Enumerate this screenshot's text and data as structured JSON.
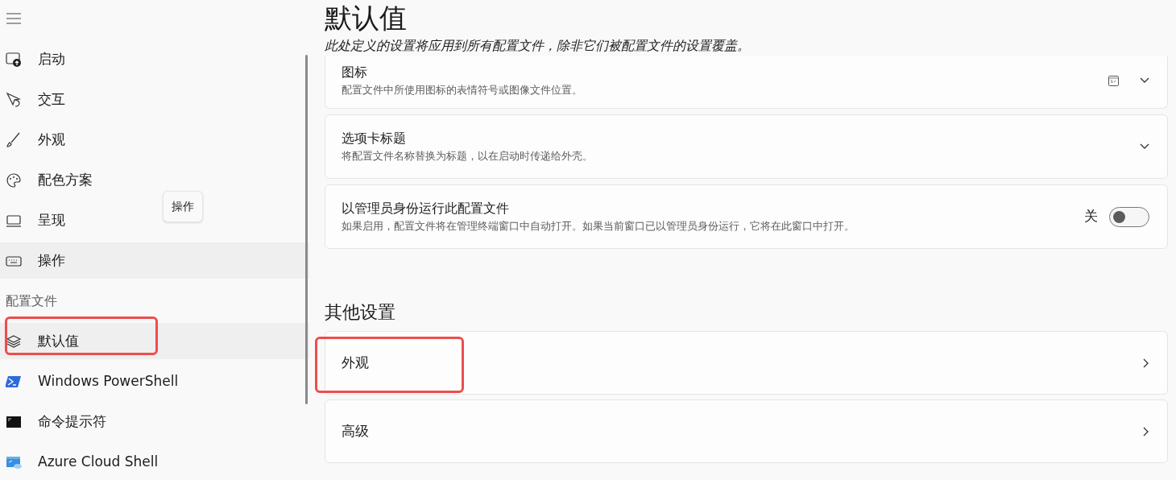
{
  "nav": [
    {
      "kind": "item",
      "label": "启动",
      "selected": false,
      "highlighted": false
    },
    {
      "kind": "item",
      "label": "交互",
      "selected": false,
      "highlighted": false
    },
    {
      "kind": "item",
      "label": "外观",
      "selected": false,
      "highlighted": false
    },
    {
      "kind": "item",
      "label": "配色方案",
      "selected": false,
      "highlighted": false
    },
    {
      "kind": "item",
      "label": "呈现",
      "selected": false,
      "highlighted": false
    },
    {
      "kind": "item",
      "label": "操作",
      "selected": true,
      "highlighted": false
    },
    {
      "kind": "header",
      "label": "配置文件"
    },
    {
      "kind": "item",
      "label": "默认值",
      "selected": true,
      "highlighted": true
    },
    {
      "kind": "item",
      "label": "Windows PowerShell",
      "selected": false,
      "highlighted": false
    },
    {
      "kind": "item",
      "label": "命令提示符",
      "selected": false,
      "highlighted": false
    },
    {
      "kind": "item",
      "label": "Azure Cloud Shell",
      "selected": false,
      "highlighted": false
    }
  ],
  "tooltip": "操作",
  "page": {
    "title": "默认值",
    "subtitle": "此处定义的设置将应用到所有配置文件，除非它们被配置文件的设置覆盖。"
  },
  "settings": [
    {
      "kind": "expander",
      "title": "图标",
      "description": "配置文件中所使用图标的表情符号或图像文件位置。",
      "preview": true
    },
    {
      "kind": "expander",
      "title": "选项卡标题",
      "description": "将配置文件名称替换为标题，以在启动时传递给外壳。"
    },
    {
      "kind": "toggle",
      "title": "以管理员身份运行此配置文件",
      "description": "如果启用，配置文件将在管理终端窗口中自动打开。如果当前窗口已以管理员身份运行，它将在此窗口中打开。",
      "on": false,
      "state": "关"
    }
  ],
  "other_section": {
    "heading": "其他设置",
    "links": [
      {
        "title": "外观",
        "highlighted": true
      },
      {
        "title": "高级",
        "highlighted": false
      }
    ]
  }
}
